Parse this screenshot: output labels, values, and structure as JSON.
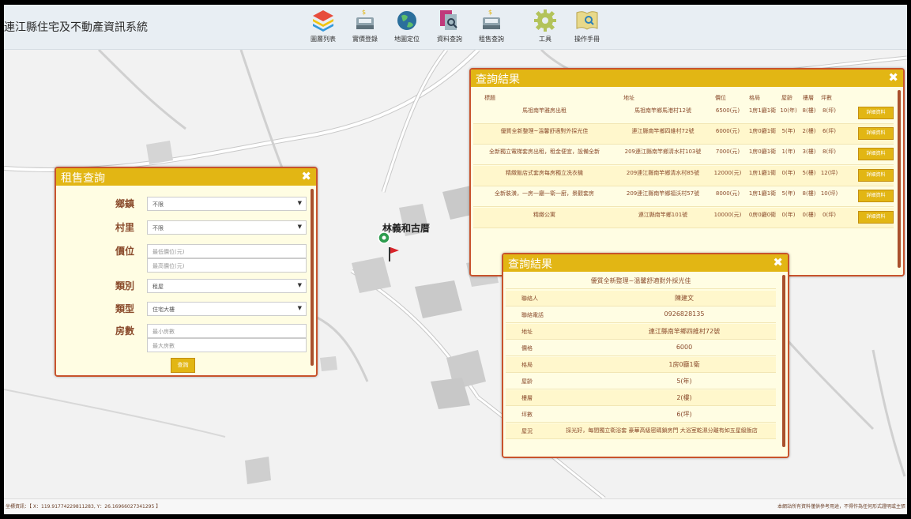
{
  "header": {
    "title": "連江縣住宅及不動產資訊系統",
    "tools": [
      {
        "label": "圖層列表",
        "icon": "layers-icon"
      },
      {
        "label": "實價登錄",
        "icon": "price-register-icon"
      },
      {
        "label": "地圖定位",
        "icon": "globe-locate-icon"
      },
      {
        "label": "資料查詢",
        "icon": "data-query-icon"
      },
      {
        "label": "租售查詢",
        "icon": "rent-sale-query-icon"
      },
      {
        "label": "工具",
        "icon": "gear-icon"
      },
      {
        "label": "操作手冊",
        "icon": "manual-icon"
      }
    ]
  },
  "map": {
    "poi_label": "林義和古厝",
    "marker_icon": "map-pin-icon",
    "flag_icon": "red-flag-icon"
  },
  "rent_query": {
    "title": "租售查詢",
    "close": "✖",
    "township_label": "鄉鎮",
    "township_value": "不限",
    "village_label": "村里",
    "village_value": "不限",
    "price_label": "價位",
    "price_min_placeholder": "最低價位(元)",
    "price_max_placeholder": "最高價位(元)",
    "category_label": "類別",
    "category_value": "租屋",
    "type_label": "類型",
    "type_value": "住宅大樓",
    "rooms_label": "房數",
    "rooms_min_placeholder": "最小房數",
    "rooms_max_placeholder": "最大房數",
    "submit": "查詢"
  },
  "results": {
    "title": "查詢結果",
    "close": "✖",
    "headers": {
      "title": "標題",
      "address": "地址",
      "price": "價位",
      "layout": "格局",
      "age": "屋齡",
      "floor": "樓層",
      "area": "坪數"
    },
    "detail_label": "詳細資料",
    "rows": [
      {
        "title": "馬祖南竿雅房出租",
        "address": "馬祖南竿鄉馬港村12號",
        "price": "6500(元)",
        "layout": "1房1廳1衛",
        "age": "10(年)",
        "floor": "8(樓)",
        "area": "8(坪)"
      },
      {
        "title": "優質全新整理~溫馨舒適對外採光佳",
        "address": "連江縣南竿鄉四維村72號",
        "price": "6000(元)",
        "layout": "1房0廳1衛",
        "age": "5(年)",
        "floor": "2(樓)",
        "area": "6(坪)"
      },
      {
        "title": "全新獨立電梯套房出租，租金便宜，設備全新",
        "address": "209連江縣南竿鄉清水村103號",
        "price": "7000(元)",
        "layout": "1房0廳1衛",
        "age": "1(年)",
        "floor": "3(樓)",
        "area": "8(坪)"
      },
      {
        "title": "精緻飯店式套房每房獨立洗衣機",
        "address": "209連江縣南竿鄉清水村85號",
        "price": "12000(元)",
        "layout": "1房1廳1衛",
        "age": "0(年)",
        "floor": "5(樓)",
        "area": "12(坪)"
      },
      {
        "title": "全新裝潢，一房一廳一衛一廚，景觀套房",
        "address": "209連江縣南竿鄉福沃村57號",
        "price": "8000(元)",
        "layout": "1房1廳1衛",
        "age": "5(年)",
        "floor": "8(樓)",
        "area": "10(坪)"
      },
      {
        "title": "精緻公寓",
        "address": "連江縣南竿鄉101號",
        "price": "10000(元)",
        "layout": "0房0廳0衛",
        "age": "0(年)",
        "floor": "0(樓)",
        "area": "0(坪)"
      }
    ]
  },
  "detail": {
    "title": "查詢結果",
    "close": "✖",
    "heading": "優質全新整理~溫馨舒適對外採光佳",
    "fields": [
      {
        "key": "聯絡人",
        "value": "陳建文"
      },
      {
        "key": "聯絡電話",
        "value": "0926828135"
      },
      {
        "key": "地址",
        "value": "連江縣南竿鄉四維村72號"
      },
      {
        "key": "價格",
        "value": "6000"
      },
      {
        "key": "格局",
        "value": "1房0廳1衛"
      },
      {
        "key": "屋齡",
        "value": "5(年)"
      },
      {
        "key": "樓層",
        "value": "2(樓)"
      },
      {
        "key": "坪數",
        "value": "6(坪)"
      },
      {
        "key": "屋況",
        "value": "採光好，每間獨立衛浴套 豪華高級密碼鎖房門 大浴室乾濕分離有如五星級飯店"
      }
    ]
  },
  "footer": {
    "coords": "坐標資訊：【 X：119.91774229811283, Y：26.16966027341295 】",
    "disclaimer": "本網站所有資料僅供參考用途，不得作為任何形式證明或主張"
  },
  "colors": {
    "accent": "#e2b614",
    "border": "#c8532c",
    "text": "#8a4b2c",
    "panel_bg": "#fffde3"
  }
}
